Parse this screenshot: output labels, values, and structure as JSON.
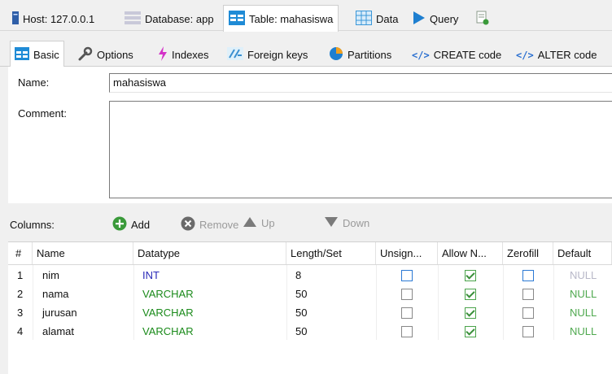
{
  "top_tabs": [
    {
      "label": "Host: 127.0.0.1",
      "icon": "server-icon"
    },
    {
      "label": "Database: app",
      "icon": "database-icon"
    },
    {
      "label": "Table: mahasiswa",
      "icon": "table-icon"
    },
    {
      "label": "Data",
      "icon": "grid-icon"
    },
    {
      "label": "Query",
      "icon": "play-icon"
    },
    {
      "label": "",
      "icon": "new-query-icon"
    }
  ],
  "sub_tabs": [
    {
      "label": "Basic"
    },
    {
      "label": "Options"
    },
    {
      "label": "Indexes"
    },
    {
      "label": "Foreign keys"
    },
    {
      "label": "Partitions"
    },
    {
      "label": "CREATE code"
    },
    {
      "label": "ALTER code"
    }
  ],
  "form": {
    "name_label": "Name:",
    "name_value": "mahasiswa",
    "comment_label": "Comment:",
    "comment_value": ""
  },
  "columns_toolbar": {
    "label": "Columns:",
    "add": "Add",
    "remove": "Remove",
    "up": "Up",
    "down": "Down"
  },
  "grid": {
    "headers": [
      "#",
      "Name",
      "Datatype",
      "Length/Set",
      "Unsign...",
      "Allow N...",
      "Zerofill",
      "Default"
    ],
    "rows": [
      {
        "num": "1",
        "name": "nim",
        "datatype": "INT",
        "length": "8",
        "unsigned": false,
        "allow_null": true,
        "zerofill": false,
        "default": "NULL"
      },
      {
        "num": "2",
        "name": "nama",
        "datatype": "VARCHAR",
        "length": "50",
        "unsigned": false,
        "allow_null": true,
        "zerofill": false,
        "default": "NULL"
      },
      {
        "num": "3",
        "name": "jurusan",
        "datatype": "VARCHAR",
        "length": "50",
        "unsigned": false,
        "allow_null": true,
        "zerofill": false,
        "default": "NULL"
      },
      {
        "num": "4",
        "name": "alamat",
        "datatype": "VARCHAR",
        "length": "50",
        "unsigned": false,
        "allow_null": true,
        "zerofill": false,
        "default": "NULL"
      }
    ]
  },
  "colors": {
    "accent_blue": "#2b79d4",
    "int_blue": "#2a2ab8",
    "varchar_green": "#1a8a1a",
    "add_green": "#3a9a3a"
  }
}
